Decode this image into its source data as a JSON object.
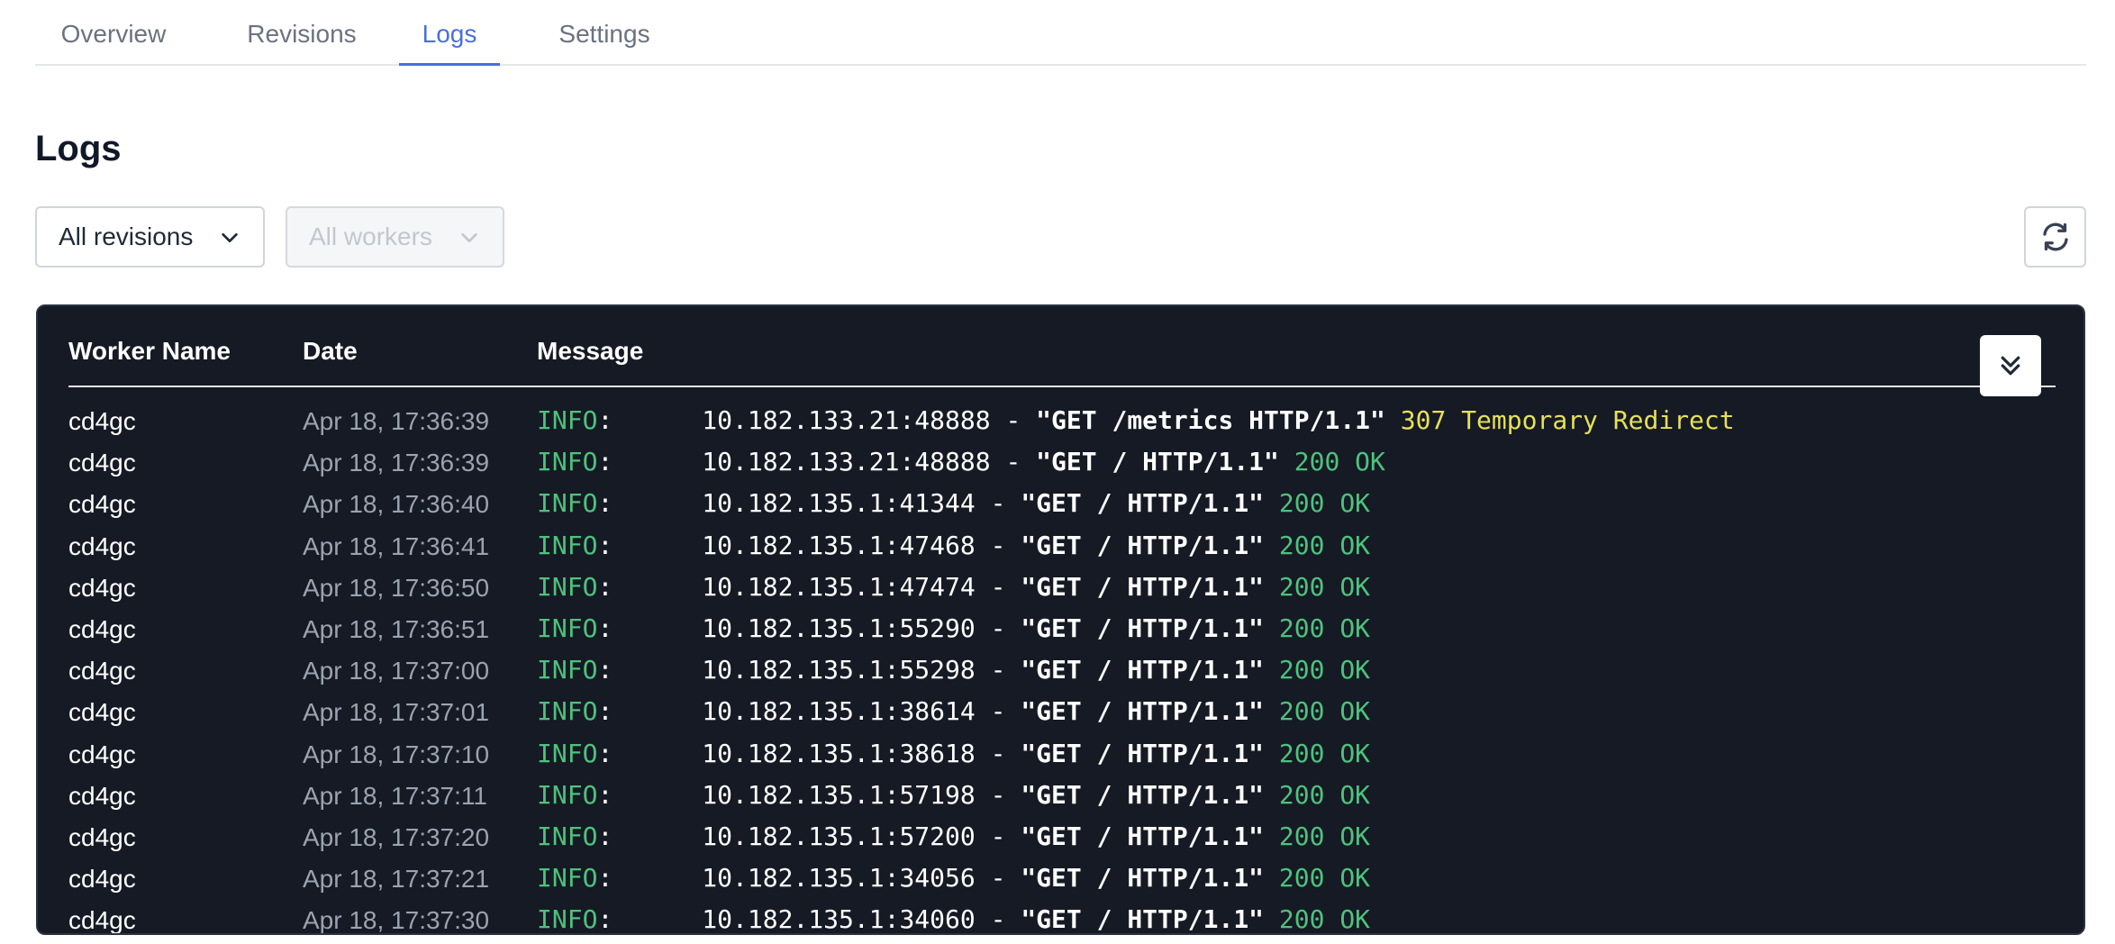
{
  "tabs": [
    {
      "label": "Overview",
      "active": false
    },
    {
      "label": "Revisions",
      "active": false
    },
    {
      "label": "Logs",
      "active": true
    },
    {
      "label": "Settings",
      "active": false
    }
  ],
  "page_title": "Logs",
  "filters": {
    "revisions": {
      "value": "All revisions",
      "disabled": false
    },
    "workers": {
      "value": "All workers",
      "disabled": true
    }
  },
  "icons": {
    "refresh": "refresh-icon",
    "scroll_bottom": "double-chevron-down-icon",
    "select_chevron": "chevron-down-icon"
  },
  "colors": {
    "accent": "#4a6fdc",
    "panel_bg": "#151a24",
    "info": "#4ec27d",
    "ok": "#4ec27d",
    "redirect": "#e6e05a"
  },
  "log_table": {
    "columns": [
      "Worker Name",
      "Date",
      "Message"
    ],
    "rows": [
      {
        "worker": "cd4gc",
        "date": "Apr 18, 17:36:39",
        "level": "INFO",
        "sep": ":",
        "addr": "10.182.133.21:48888 - ",
        "request": "\"GET /metrics HTTP/1.1\"",
        "status": "307 Temporary Redirect",
        "status_kind": "redirect"
      },
      {
        "worker": "cd4gc",
        "date": "Apr 18, 17:36:39",
        "level": "INFO",
        "sep": ":",
        "addr": "10.182.133.21:48888 - ",
        "request": "\"GET / HTTP/1.1\"",
        "status": "200 OK",
        "status_kind": "ok"
      },
      {
        "worker": "cd4gc",
        "date": "Apr 18, 17:36:40",
        "level": "INFO",
        "sep": ":",
        "addr": "10.182.135.1:41344 - ",
        "request": "\"GET / HTTP/1.1\"",
        "status": "200 OK",
        "status_kind": "ok"
      },
      {
        "worker": "cd4gc",
        "date": "Apr 18, 17:36:41",
        "level": "INFO",
        "sep": ":",
        "addr": "10.182.135.1:47468 - ",
        "request": "\"GET / HTTP/1.1\"",
        "status": "200 OK",
        "status_kind": "ok"
      },
      {
        "worker": "cd4gc",
        "date": "Apr 18, 17:36:50",
        "level": "INFO",
        "sep": ":",
        "addr": "10.182.135.1:47474 - ",
        "request": "\"GET / HTTP/1.1\"",
        "status": "200 OK",
        "status_kind": "ok"
      },
      {
        "worker": "cd4gc",
        "date": "Apr 18, 17:36:51",
        "level": "INFO",
        "sep": ":",
        "addr": "10.182.135.1:55290 - ",
        "request": "\"GET / HTTP/1.1\"",
        "status": "200 OK",
        "status_kind": "ok"
      },
      {
        "worker": "cd4gc",
        "date": "Apr 18, 17:37:00",
        "level": "INFO",
        "sep": ":",
        "addr": "10.182.135.1:55298 - ",
        "request": "\"GET / HTTP/1.1\"",
        "status": "200 OK",
        "status_kind": "ok"
      },
      {
        "worker": "cd4gc",
        "date": "Apr 18, 17:37:01",
        "level": "INFO",
        "sep": ":",
        "addr": "10.182.135.1:38614 - ",
        "request": "\"GET / HTTP/1.1\"",
        "status": "200 OK",
        "status_kind": "ok"
      },
      {
        "worker": "cd4gc",
        "date": "Apr 18, 17:37:10",
        "level": "INFO",
        "sep": ":",
        "addr": "10.182.135.1:38618 - ",
        "request": "\"GET / HTTP/1.1\"",
        "status": "200 OK",
        "status_kind": "ok"
      },
      {
        "worker": "cd4gc",
        "date": "Apr 18, 17:37:11",
        "level": "INFO",
        "sep": ":",
        "addr": "10.182.135.1:57198 - ",
        "request": "\"GET / HTTP/1.1\"",
        "status": "200 OK",
        "status_kind": "ok"
      },
      {
        "worker": "cd4gc",
        "date": "Apr 18, 17:37:20",
        "level": "INFO",
        "sep": ":",
        "addr": "10.182.135.1:57200 - ",
        "request": "\"GET / HTTP/1.1\"",
        "status": "200 OK",
        "status_kind": "ok"
      },
      {
        "worker": "cd4gc",
        "date": "Apr 18, 17:37:21",
        "level": "INFO",
        "sep": ":",
        "addr": "10.182.135.1:34056 - ",
        "request": "\"GET / HTTP/1.1\"",
        "status": "200 OK",
        "status_kind": "ok"
      },
      {
        "worker": "cd4gc",
        "date": "Apr 18, 17:37:30",
        "level": "INFO",
        "sep": ":",
        "addr": "10.182.135.1:34060 - ",
        "request": "\"GET / HTTP/1.1\"",
        "status": "200 OK",
        "status_kind": "ok"
      }
    ]
  }
}
